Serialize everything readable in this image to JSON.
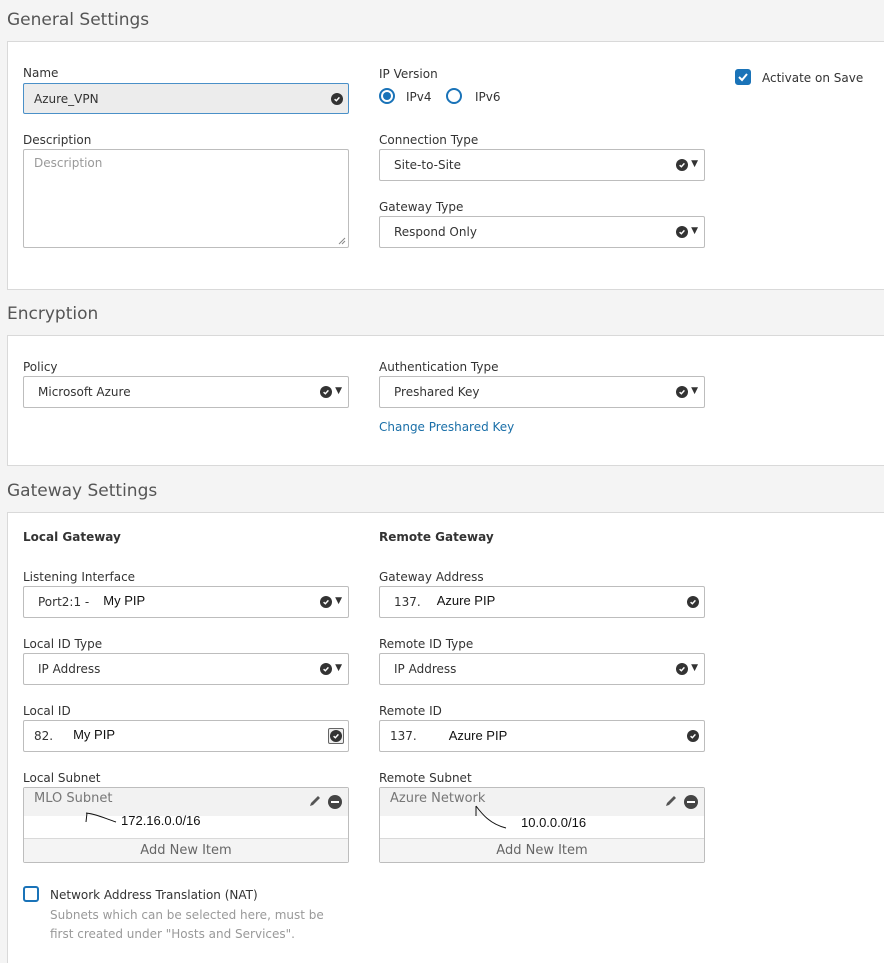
{
  "general": {
    "title": "General Settings",
    "name_label": "Name",
    "name_value": "Azure_VPN",
    "description_label": "Description",
    "description_placeholder": "Description",
    "ip_version_label": "IP Version",
    "ipv4_label": "IPv4",
    "ipv6_label": "IPv6",
    "ip_version_selected": "IPv4",
    "activate_label": "Activate on Save",
    "activate_checked": true,
    "connection_type_label": "Connection Type",
    "connection_type_value": "Site-to-Site",
    "gateway_type_label": "Gateway Type",
    "gateway_type_value": "Respond Only"
  },
  "encryption": {
    "title": "Encryption",
    "policy_label": "Policy",
    "policy_value": "Microsoft Azure",
    "auth_type_label": "Authentication Type",
    "auth_type_value": "Preshared Key",
    "change_key_link": "Change Preshared Key"
  },
  "gateway": {
    "title": "Gateway Settings",
    "local": {
      "heading": "Local Gateway",
      "listening_label": "Listening Interface",
      "listening_value": "Port2:1 -",
      "listening_annotation": "My PIP",
      "id_type_label": "Local ID Type",
      "id_type_value": "IP Address",
      "id_label": "Local ID",
      "id_value": "82.",
      "id_annotation": "My PIP",
      "subnet_label": "Local Subnet",
      "subnet_item": "MLO Subnet",
      "subnet_annotation": "172.16.0.0/16",
      "add_item": "Add New Item"
    },
    "remote": {
      "heading": "Remote Gateway",
      "address_label": "Gateway Address",
      "address_value": "137.",
      "address_annotation": "Azure PIP",
      "id_type_label": "Remote ID Type",
      "id_type_value": "IP Address",
      "id_label": "Remote ID",
      "id_value": "137.",
      "id_annotation": "Azure PIP",
      "subnet_label": "Remote Subnet",
      "subnet_item": "Azure Network",
      "subnet_annotation": "10.0.0.0/16",
      "add_item": "Add New Item"
    },
    "nat_label": "Network Address Translation (NAT)",
    "nat_checked": false,
    "nat_hint_line1": "Subnets which can be selected here, must be",
    "nat_hint_line2": "first created under \"Hosts and Services\"."
  },
  "icons": {
    "valid": "check-circle-icon",
    "dropdown": "caret-down-icon",
    "edit": "pencil-icon",
    "remove": "minus-circle-icon"
  },
  "colors": {
    "accent": "#1a73b8",
    "link": "#1a6fa8",
    "border": "#bdbdbd",
    "background": "#f4f4f4"
  }
}
